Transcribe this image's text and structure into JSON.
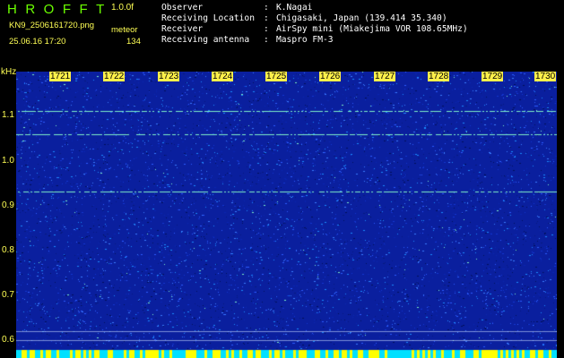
{
  "app": {
    "title": "HROFFT",
    "version": "1.0.0f",
    "filename": "KN9_2506161720.png",
    "mode": "meteor",
    "datetime": "25.06.16 17:20",
    "count": "134"
  },
  "info": [
    {
      "label": "Observer",
      "value": "K.Nagai"
    },
    {
      "label": "Receiving Location",
      "value": "Chigasaki, Japan (139.414 35.340)"
    },
    {
      "label": "Receiver",
      "value": "AirSpy mini (Miakejima VOR 108.65MHz)"
    },
    {
      "label": "Receiving antenna",
      "value": "Maspro FM-3"
    }
  ],
  "spectrogram": {
    "y_unit": "kHz",
    "y_ticks": [
      "1.1",
      "1.0",
      "0.9",
      "0.8",
      "0.7",
      "0.6"
    ],
    "x_ticks": [
      "1721",
      "1722",
      "1723",
      "1724",
      "1725",
      "1726",
      "1727",
      "1728",
      "1729",
      "1730"
    ],
    "colors": {
      "background": "#0a1f9e",
      "noise_dark": "#02105a",
      "noise_light": "#2c5cff",
      "signal": "#7ff0c8",
      "label_bg": "#fff04a",
      "bottom_bar_a": "#ffff00",
      "bottom_bar_b": "#00e0ff"
    }
  }
}
